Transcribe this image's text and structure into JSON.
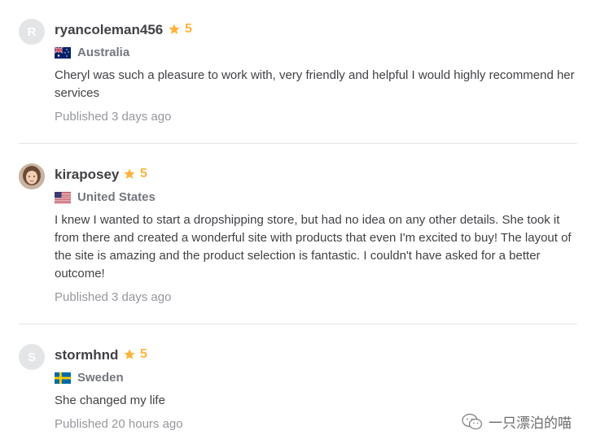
{
  "colors": {
    "star": "#ffb33e",
    "text": "#404145",
    "muted": "#74767e",
    "published": "#95979d"
  },
  "reviews": [
    {
      "avatar_letter": "R",
      "username": "ryancoleman456",
      "rating": "5",
      "country": "Australia",
      "flag_icon": "australia-flag-icon",
      "text": "Cheryl was such a pleasure to work with, very friendly and helpful I would highly recommend her services",
      "published": "Published 3 days ago"
    },
    {
      "avatar_letter": "",
      "username": "kiraposey",
      "rating": "5",
      "country": "United States",
      "flag_icon": "united-states-flag-icon",
      "text": "I knew I wanted to start a dropshipping store, but had no idea on any other details. She took it from there and created a wonderful site with products that even I'm excited to buy! The layout of the site is amazing and the product selection is fantastic. I couldn't have asked for a better outcome!",
      "published": "Published 3 days ago"
    },
    {
      "avatar_letter": "S",
      "username": "stormhnd",
      "rating": "5",
      "country": "Sweden",
      "flag_icon": "sweden-flag-icon",
      "text": "She changed my life",
      "published": "Published 20 hours ago"
    }
  ],
  "watermark": {
    "text": "一只漂泊的喵",
    "icon": "wechat-icon"
  }
}
